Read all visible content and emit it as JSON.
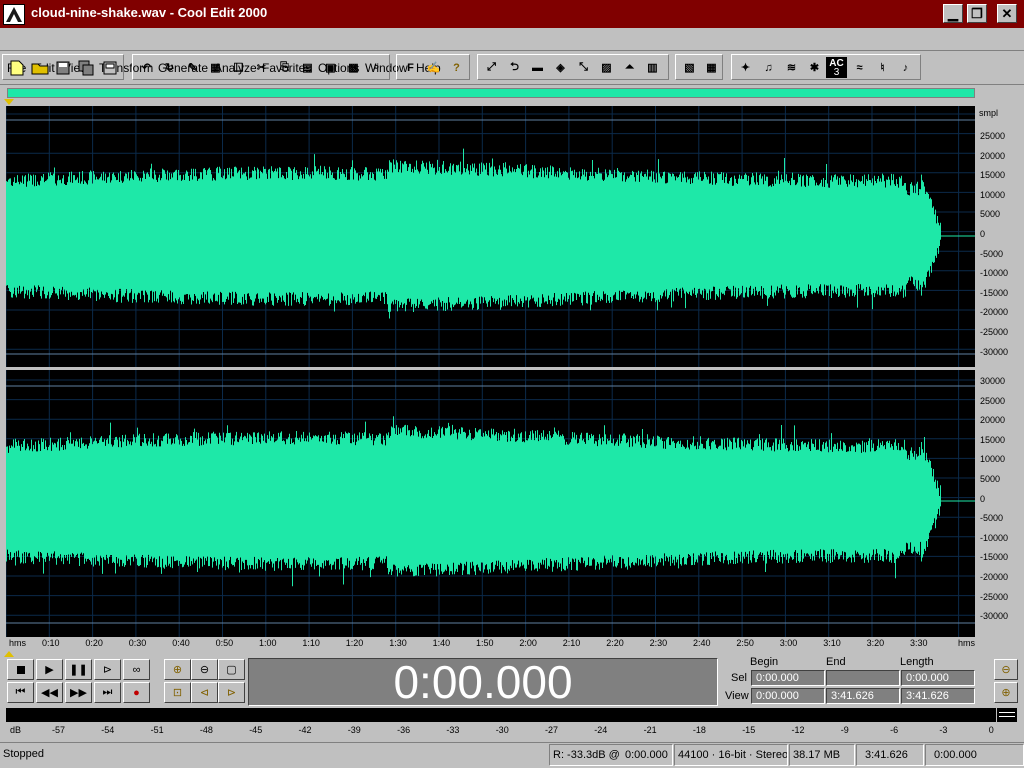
{
  "window": {
    "title": "cloud-nine-shake.wav - Cool Edit 2000"
  },
  "menu": [
    "File",
    "Edit",
    "View",
    "Transform",
    "Generate",
    "Analyze",
    "Favorites",
    "Options",
    "Window",
    "Help"
  ],
  "toolbar": {
    "f_label": "F",
    "help_label": "?",
    "ac_label": "AC",
    "ac_sub": "3"
  },
  "waveform": {
    "color": "#1ee8a8",
    "amplitude_unit": "smpl",
    "top_channel_ticks": [
      "25000",
      "20000",
      "15000",
      "10000",
      "5000",
      "0",
      "-5000",
      "-10000",
      "-15000",
      "-20000",
      "-25000",
      "-30000"
    ],
    "bottom_channel_ticks": [
      "30000",
      "25000",
      "20000",
      "15000",
      "10000",
      "5000",
      "0",
      "-5000",
      "-10000",
      "-15000",
      "-20000",
      "-25000",
      "-30000"
    ]
  },
  "time_ruler": {
    "unit_left": "hms",
    "unit_right": "hms",
    "ticks": [
      "0:10",
      "0:20",
      "0:30",
      "0:40",
      "0:50",
      "1:00",
      "1:10",
      "1:20",
      "1:30",
      "1:40",
      "1:50",
      "2:00",
      "2:10",
      "2:20",
      "2:30",
      "2:40",
      "2:50",
      "3:00",
      "3:10",
      "3:20",
      "3:30"
    ]
  },
  "transport": {
    "time_display": "0:00.000"
  },
  "selection": {
    "col_begin": "Begin",
    "col_end": "End",
    "col_length": "Length",
    "row_sel": "Sel",
    "row_view": "View",
    "sel_begin": "0:00.000",
    "sel_end": "",
    "sel_length": "0:00.000",
    "view_begin": "0:00.000",
    "view_end": "3:41.626",
    "view_length": "3:41.626"
  },
  "level_meter": {
    "unit": "dB",
    "ticks": [
      "-57",
      "-54",
      "-51",
      "-48",
      "-45",
      "-42",
      "-39",
      "-36",
      "-33",
      "-30",
      "-27",
      "-24",
      "-21",
      "-18",
      "-15",
      "-12",
      "-9",
      "-6",
      "-3",
      "0"
    ]
  },
  "status": {
    "state": "Stopped",
    "cursor_level": "R: -33.3dB @",
    "cursor_time": "0:00.000",
    "format": "44100 · 16-bit · Stereo",
    "file_size": "38.17 MB",
    "duration": "3:41.626",
    "position": "0:00.000"
  }
}
